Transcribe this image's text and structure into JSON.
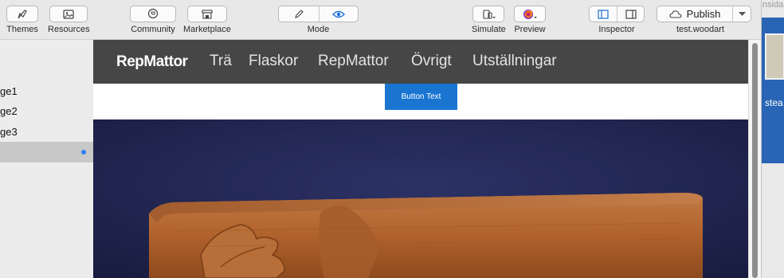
{
  "toolbar": {
    "themes": "Themes",
    "resources": "Resources",
    "community": "Community",
    "marketplace": "Marketplace",
    "mode": "Mode",
    "simulate": "Simulate",
    "preview": "Preview",
    "inspector": "Inspector",
    "publish": "Publish",
    "site_name": "test.woodart"
  },
  "sidebar": {
    "items": [
      {
        "label": "ge1"
      },
      {
        "label": "ge2"
      },
      {
        "label": "ge3"
      },
      {
        "label": ""
      }
    ]
  },
  "site": {
    "brand": "RepMattor",
    "nav": [
      "Trä",
      "Flaskor",
      "RepMattor",
      "Övrigt",
      "Utställningar"
    ],
    "button_text": "Button Text"
  },
  "right_window": {
    "top_text": "nsida",
    "thumb_label": "stea"
  },
  "colors": {
    "nav_bg": "#464646",
    "button_blue": "#1a75d1",
    "selection_dot": "#2e7cf6",
    "hero_bg": "#21254f"
  }
}
